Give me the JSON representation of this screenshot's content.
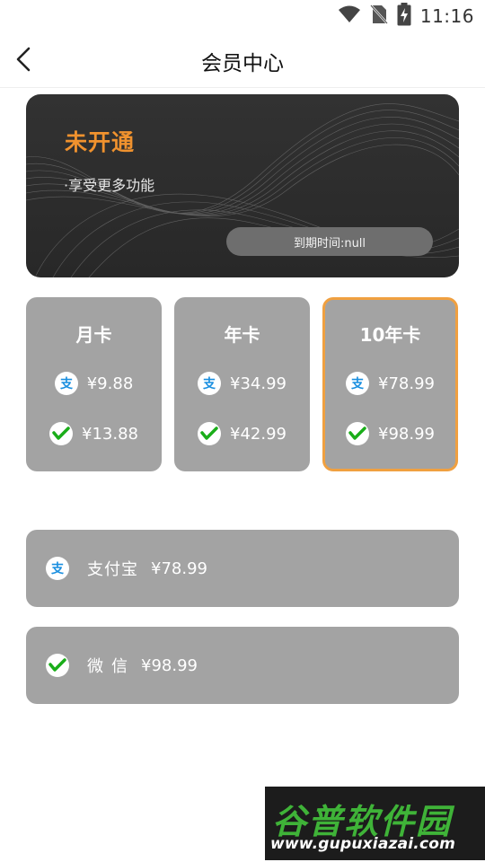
{
  "status_bar": {
    "time": "11:16",
    "icons": [
      "wifi-icon",
      "no-sim-icon",
      "battery-charging-icon"
    ]
  },
  "header": {
    "title": "会员中心",
    "back_icon": "chevron-left-icon"
  },
  "membership": {
    "status": "未开通",
    "benefit": "·享受更多功能",
    "expire_text": "到期时间:null",
    "accent_color": "#f0922e"
  },
  "plans": [
    {
      "name": "月卡",
      "alipay_price": "¥9.88",
      "wechat_price": "¥13.88",
      "selected": false
    },
    {
      "name": "年卡",
      "alipay_price": "¥34.99",
      "wechat_price": "¥42.99",
      "selected": false
    },
    {
      "name": "10年卡",
      "alipay_price": "¥78.99",
      "wechat_price": "¥98.99",
      "selected": true
    }
  ],
  "payment": {
    "alipay": {
      "label": "支付宝",
      "amount": "¥78.99",
      "icon": "alipay-icon"
    },
    "wechat": {
      "label": "微信",
      "amount": "¥98.99",
      "icon": "wechat-pay-icon"
    }
  },
  "colors": {
    "selected_border": "#f0a040",
    "card_gray": "#a3a3a3",
    "alipay_blue": "#1a8fe0",
    "wechat_green": "#1aad19"
  },
  "watermark": {
    "name": "谷普软件园",
    "url": "www.gupuxiazai.com"
  }
}
